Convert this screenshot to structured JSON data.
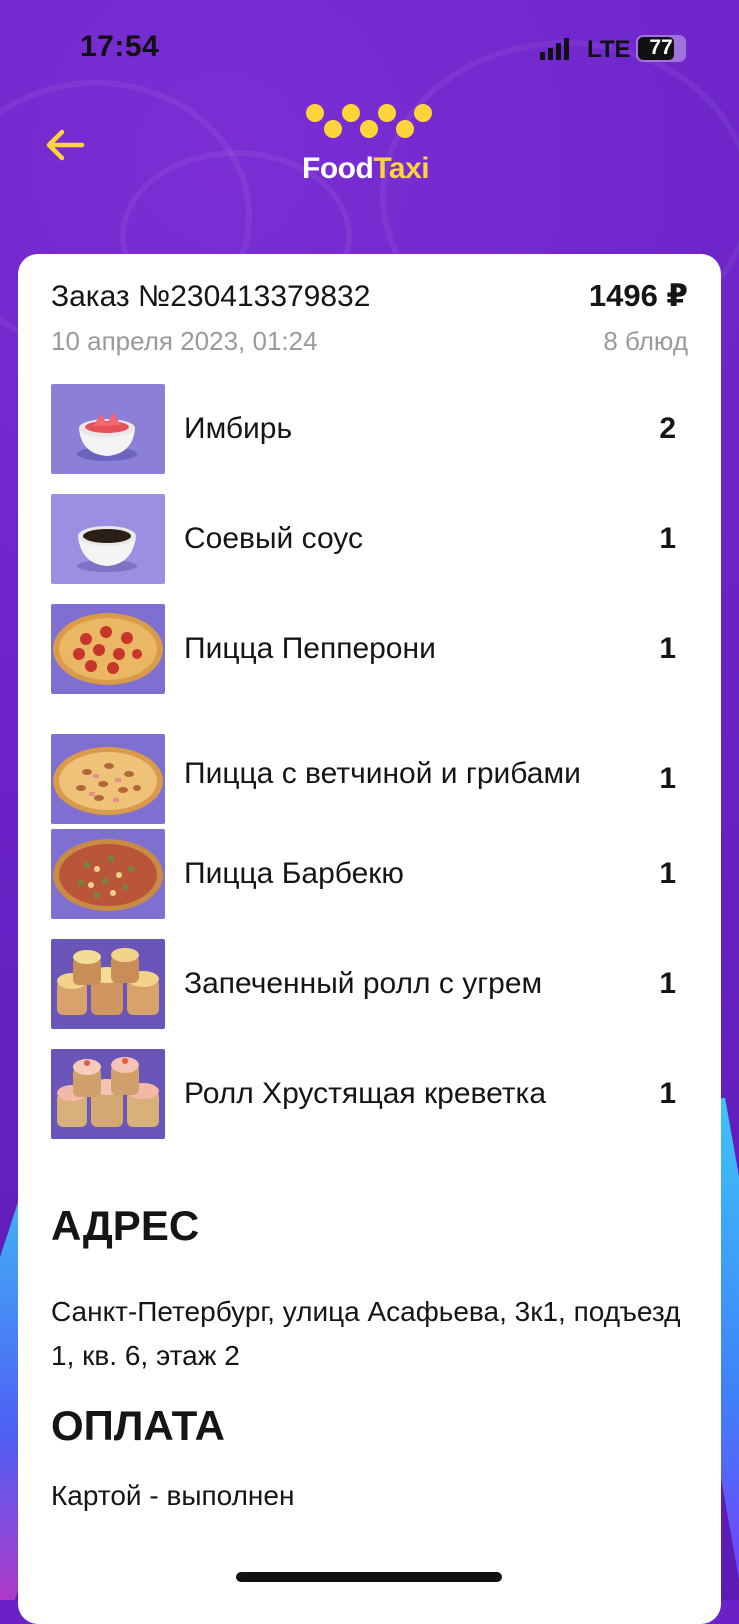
{
  "status_bar": {
    "time": "17:54",
    "network": "LTE",
    "battery": "77"
  },
  "header": {
    "logo_food": "Food",
    "logo_taxi": "Taxi"
  },
  "order": {
    "title": "Заказ №230413379832",
    "total": "1496 ₽",
    "date": "10 апреля 2023, 01:24",
    "count": "8 блюд",
    "items": [
      {
        "name": "Имбирь",
        "qty": "2",
        "image": "ginger-image"
      },
      {
        "name": "Соевый соус",
        "qty": "1",
        "image": "soy-sauce-image"
      },
      {
        "name": "Пицца Пепперони",
        "qty": "1",
        "image": "pizza-image"
      },
      {
        "name": "Пицца с ветчиной и грибами",
        "qty": "1",
        "image": "pizza-image"
      },
      {
        "name": "Пицца Барбекю",
        "qty": "1",
        "image": "pizza-image"
      },
      {
        "name": "Запеченный ролл с угрем",
        "qty": "1",
        "image": "roll-image"
      },
      {
        "name": "Ролл Хрустящая креветка",
        "qty": "1",
        "image": "roll-image"
      }
    ]
  },
  "address": {
    "heading": "АДРЕС",
    "text": "Санкт-Петербург, улица Асафьева, 3к1, подъезд 1, кв. 6, этаж 2"
  },
  "payment": {
    "heading": "ОПЛАТА",
    "text": "Картой - выполнен"
  },
  "colors": {
    "brand_purple": "#6a22c6",
    "brand_yellow": "#ffd43b",
    "card": "#ffffff"
  }
}
